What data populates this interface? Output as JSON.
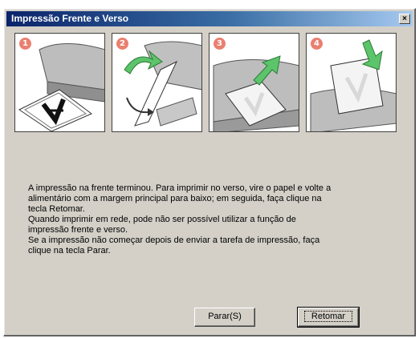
{
  "window": {
    "title": "Impressão Frente e Verso",
    "close_glyph": "×"
  },
  "steps": [
    {
      "number": "1"
    },
    {
      "number": "2"
    },
    {
      "number": "3"
    },
    {
      "number": "4"
    }
  ],
  "message": {
    "lines": [
      "A impressão na frente terminou. Para imprimir no verso, vire o papel e volte a",
      "alimentário com a margem principal para baixo; em seguida, faça clique na",
      "tecla Retomar.",
      "Quando imprimir em rede, pode não ser possível utilizar a função de",
      "impressão frente e verso.",
      "Se a impressão não começar depois de enviar a tarefa de impressão, faça",
      "clique na tecla Parar."
    ]
  },
  "buttons": {
    "stop_label": "Parar(S)",
    "resume_label": "Retomar"
  },
  "colors": {
    "titlebar_start": "#0a246a",
    "titlebar_end": "#a6caf0",
    "arrow_green": "#5cc46a",
    "badge": "#e98070",
    "dialog_bg": "#d4d0c8"
  }
}
